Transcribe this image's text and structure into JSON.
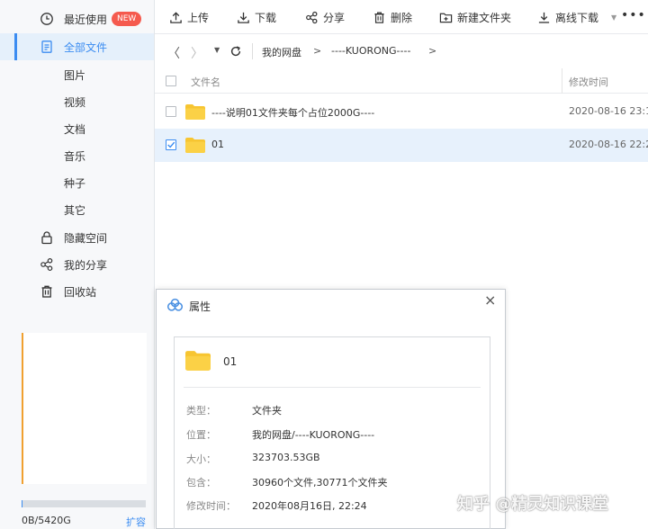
{
  "sidebar": {
    "items": [
      {
        "label": "最近使用",
        "icon": "clock-icon"
      },
      {
        "label": "全部文件",
        "icon": "file-icon"
      },
      {
        "label": "图片"
      },
      {
        "label": "视频"
      },
      {
        "label": "文档"
      },
      {
        "label": "音乐"
      },
      {
        "label": "种子"
      },
      {
        "label": "其它"
      },
      {
        "label": "隐藏空间",
        "icon": "lock-icon"
      },
      {
        "label": "我的分享",
        "icon": "share-icon"
      },
      {
        "label": "回收站",
        "icon": "trash-icon"
      }
    ],
    "new_badge": "NEW",
    "quota": "0B/5420G",
    "quota_fraction": 0.01,
    "expand": "扩容"
  },
  "toolbar": {
    "upload": "上传",
    "download": "下载",
    "share": "分享",
    "delete": "删除",
    "new_folder": "新建文件夹",
    "offline_download": "离线下载",
    "more": "•••"
  },
  "breadcrumb": {
    "root": "我的网盘",
    "current": "----KUORONG----",
    "separator": ">"
  },
  "table": {
    "col_name": "文件名",
    "col_modified": "修改时间",
    "rows": [
      {
        "name": "----说明01文件夹每个占位2000G----",
        "modified": "2020-08-16 23:1",
        "checked": false
      },
      {
        "name": "01",
        "modified": "2020-08-16 22:2",
        "checked": true
      }
    ]
  },
  "dialog": {
    "title": "属性",
    "close": "×",
    "file_name": "01",
    "props": [
      {
        "key": "类型：",
        "value": "文件夹"
      },
      {
        "key": "位置：",
        "value": "我的网盘/----KUORONG----"
      },
      {
        "key": "大小：",
        "value": "323703.53GB"
      },
      {
        "key": "包含：",
        "value": "30960个文件,30771个文件夹"
      },
      {
        "key": "修改时间：",
        "value": "2020年08月16日, 22:24"
      }
    ]
  },
  "watermark": "知乎 @精灵知识课堂",
  "colors": {
    "accent": "#3b8cf1",
    "folder": "#f7c531",
    "badge": "#f55a4e",
    "selected_row": "#e7f1fc"
  }
}
